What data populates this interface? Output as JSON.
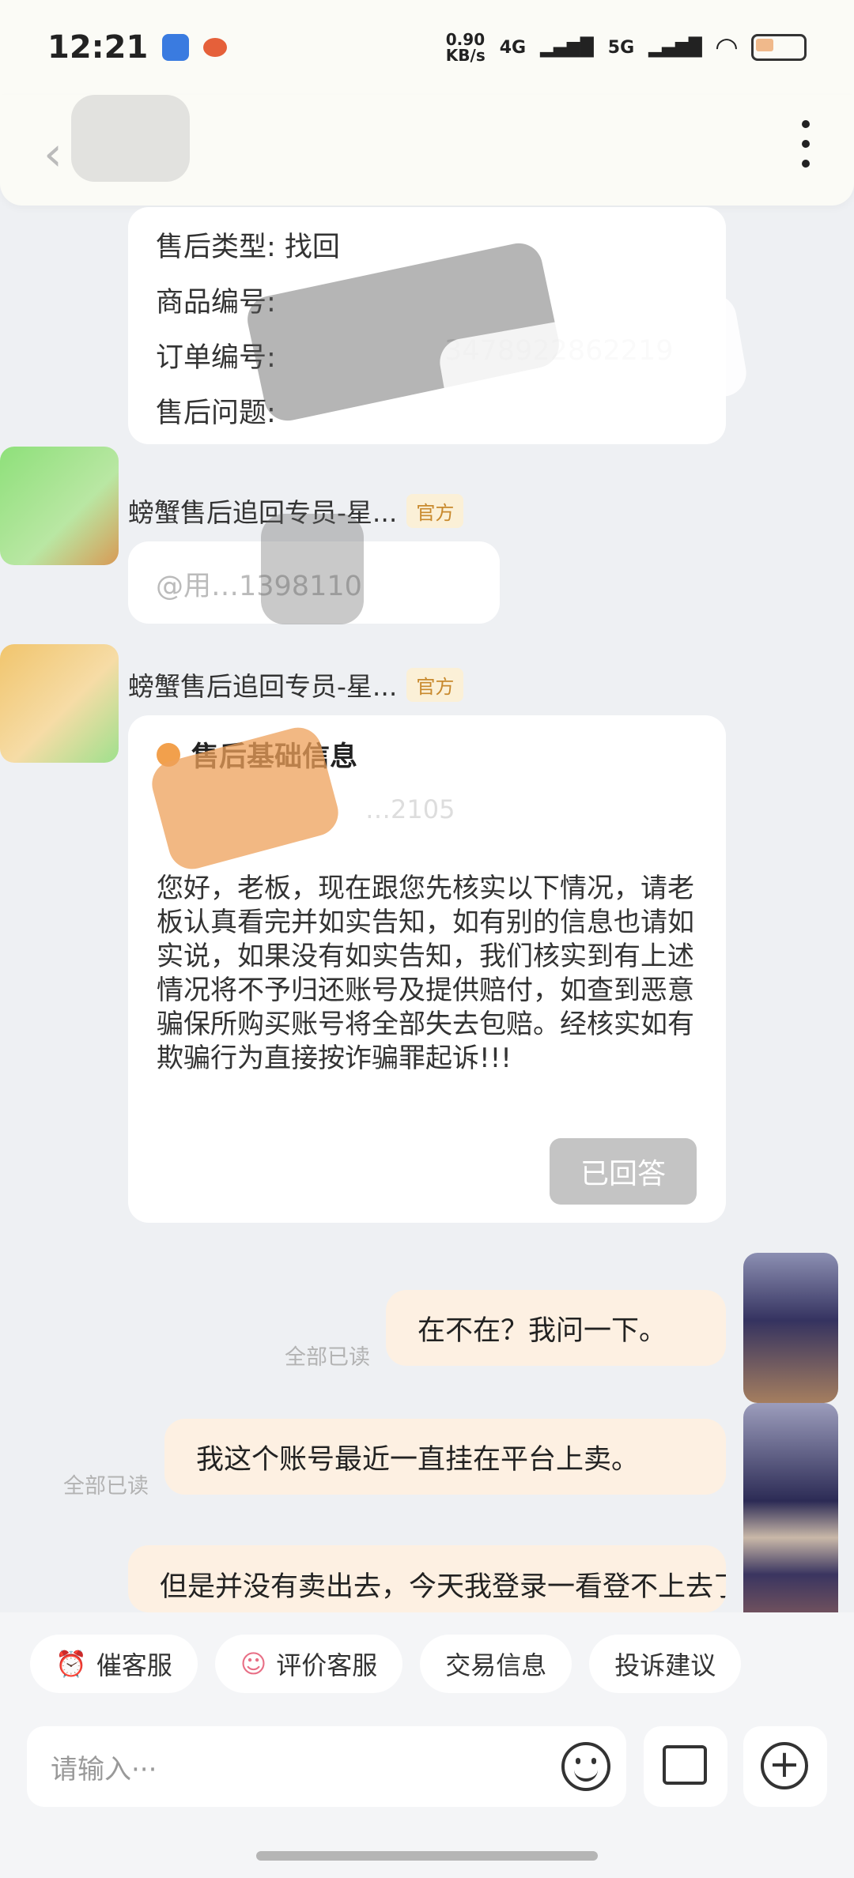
{
  "status": {
    "time": "12:21",
    "net_speed": "0.90\nKB/s",
    "sig1": "4G",
    "sig2": "5G"
  },
  "info_card": {
    "lines": [
      "售后类型: 找回",
      "商品编号: ",
      "订单编号: ",
      "售后问题: "
    ],
    "order_tail": "3478922862219"
  },
  "msg1": {
    "sender": "螃蟹售后追回专员-星...",
    "badge": "官方",
    "text": "@用…1398110"
  },
  "msg2": {
    "sender": "螃蟹售后追回专员-星...",
    "badge": "官方",
    "title": "售后基础信息",
    "subtitle": "…2105",
    "body": "您好，老板，现在跟您先核实以下情况，请老板认真看完并如实告知，如有别的信息也请如实说，如果没有如实告知，我们核实到有上述情况将不予归还账号及提供赔付，如查到恶意骗保所购买账号将全部失去包赔。经核实如有欺骗行为直接按诈骗罪起诉!!!",
    "answered_label": "已回答"
  },
  "out1": {
    "text": "在不在？我问一下。",
    "read": "全部已读"
  },
  "out2": {
    "text": "我这个账号最近一直挂在平台上卖。",
    "read": "全部已读"
  },
  "out3": {
    "text": "但是并没有卖出去，今天我登录一看登不上去了"
  },
  "quick": [
    "催客服",
    "评价客服",
    "交易信息",
    "投诉建议"
  ],
  "input": {
    "placeholder": "请输入···"
  }
}
